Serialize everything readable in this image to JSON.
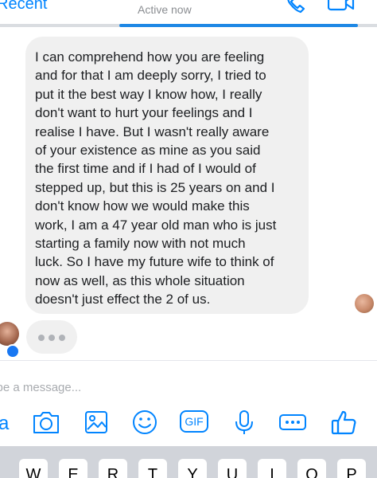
{
  "header": {
    "back_label": "Recent",
    "status": "Active now"
  },
  "message": {
    "text": "I can comprehend how you are feeling\nand for that I am deeply sorry, I tried to\nput it the best way I know how, I really\ndon't want to hurt your feelings and I\nrealise I have. But I wasn't really aware\nof your existence as mine as you said\nthe first time and if I had of I would of\nstepped up, but this is 25 years on and I\ndon't know how we would make this\nwork, I am a 47 year old man who is just\nstarting a family now with not much\nluck. So I have my future wife to think of\nnow as well, as this whole situation\ndoesn't just effect the 2 of us."
  },
  "composer": {
    "placeholder": "ype a message...",
    "value": "",
    "gif_label": "GIF",
    "aa_label": "a"
  },
  "keyboard": {
    "keys": [
      "W",
      "E",
      "R",
      "T",
      "Y",
      "U",
      "I",
      "O",
      "P"
    ]
  },
  "colors": {
    "accent": "#0084ff",
    "bubble": "#f0f0f0",
    "text": "#1c1e21"
  },
  "icons": {
    "call": "phone-icon",
    "video": "video-camera-icon",
    "camera": "camera-icon",
    "gallery": "gallery-icon",
    "emoji": "emoji-icon",
    "gif": "gif-icon",
    "mic": "microphone-icon",
    "more": "more-icon",
    "like": "thumbs-up-icon"
  }
}
